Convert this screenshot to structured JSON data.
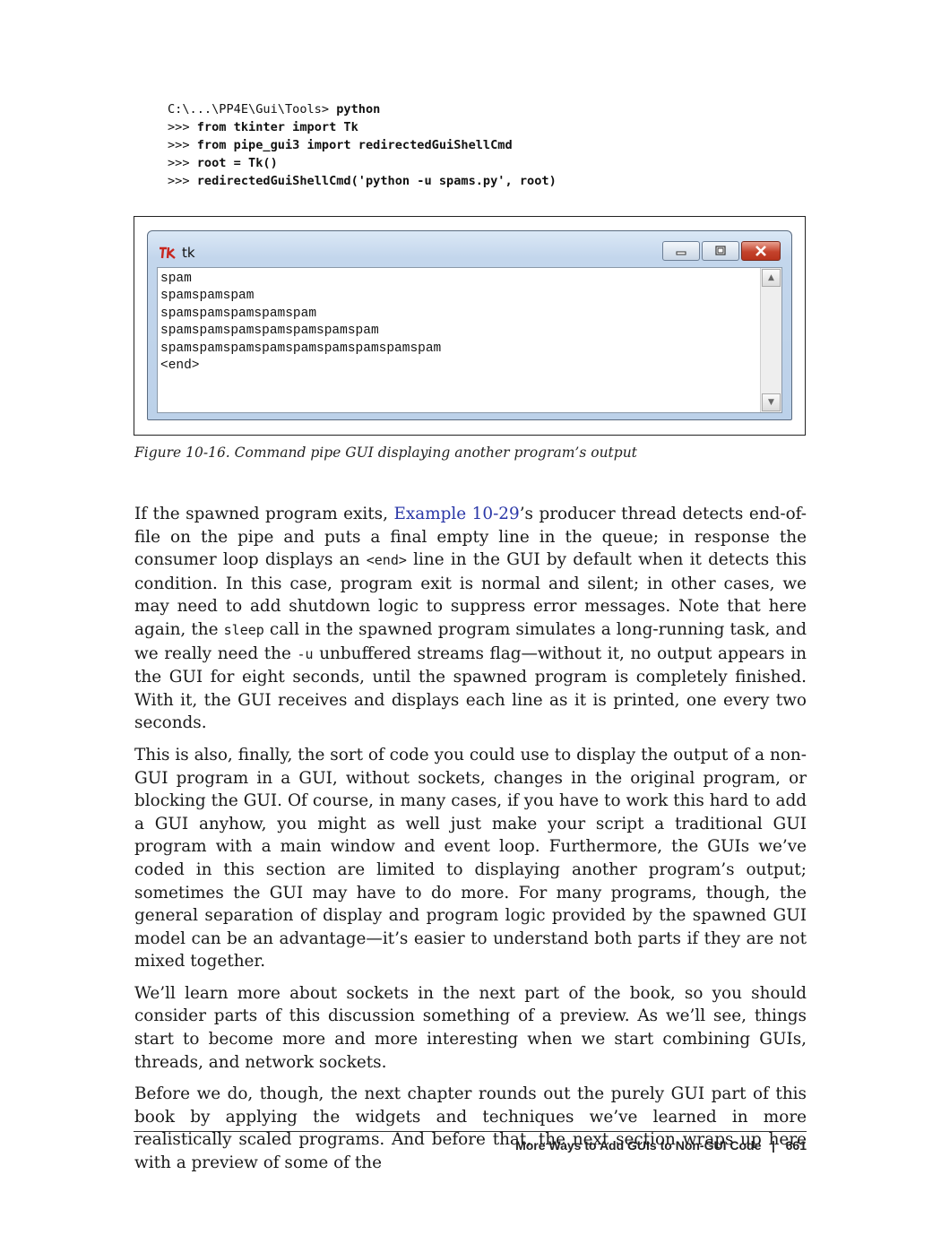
{
  "code": {
    "prompt_line": "C:\\...\\PP4E\\Gui\\Tools> ",
    "cmd": "python",
    "ps1": ">>> ",
    "lines": [
      "from tkinter import Tk",
      "from pipe_gui3 import redirectedGuiShellCmd",
      "root = Tk()",
      "redirectedGuiShellCmd('python -u spams.py', root)"
    ]
  },
  "window": {
    "title": "tk",
    "output": [
      "spam",
      "spamspamspam",
      "spamspamspamspamspam",
      "spamspamspamspamspamspamspam",
      "spamspamspamspamspamspamspamspamspam",
      "<end>"
    ],
    "scroll_up": "▲",
    "scroll_down": "▼"
  },
  "caption": "Figure 10-16. Command pipe GUI displaying another program’s output",
  "p1": {
    "a": "If the spawned program exits, ",
    "link": "Example 10-29",
    "b": "’s producer thread detects end-of-file on the pipe and puts a final empty line in the queue; in response the consumer loop displays an ",
    "code1": "<end>",
    "c": " line in the GUI by default when it detects this condition. In this case, program exit is normal and silent; in other cases, we may need to add shutdown logic to suppress error messages. Note that here again, the ",
    "code2": "sleep",
    "d": " call in the spawned program simulates a long-running task, and we really need the ",
    "code3": "-u",
    "e": " unbuffered streams flag—without it, no output appears in the GUI for eight seconds, until the spawned program is completely finished. With it, the GUI receives and displays each line as it is printed, one every two seconds."
  },
  "p2": "This is also, finally, the sort of code you could use to display the output of a non-GUI program in a GUI, without sockets, changes in the original program, or blocking the GUI. Of course, in many cases, if you have to work this hard to add a GUI anyhow, you might as well just make your script a traditional GUI program with a main window and event loop. Furthermore, the GUIs we’ve coded in this section are limited to displaying another program’s output; sometimes the GUI may have to do more. For many programs, though, the general separation of display and program logic provided by the spawned GUI model can be an advantage—it’s easier to understand both parts if they are not mixed together.",
  "p3": "We’ll learn more about sockets in the next part of the book, so you should consider parts of this discussion something of a preview. As we’ll see, things start to become more and more interesting when we start combining GUIs, threads, and network sockets.",
  "p4": "Before we do, though, the next chapter rounds out the purely GUI part of this book by applying the widgets and techniques we’ve learned in more realistically scaled programs. And before that, the next section wraps up here with a preview of some of the",
  "footer": {
    "section": "More Ways to Add GUIs to Non-GUI Code",
    "sep": "|",
    "page": "661"
  }
}
